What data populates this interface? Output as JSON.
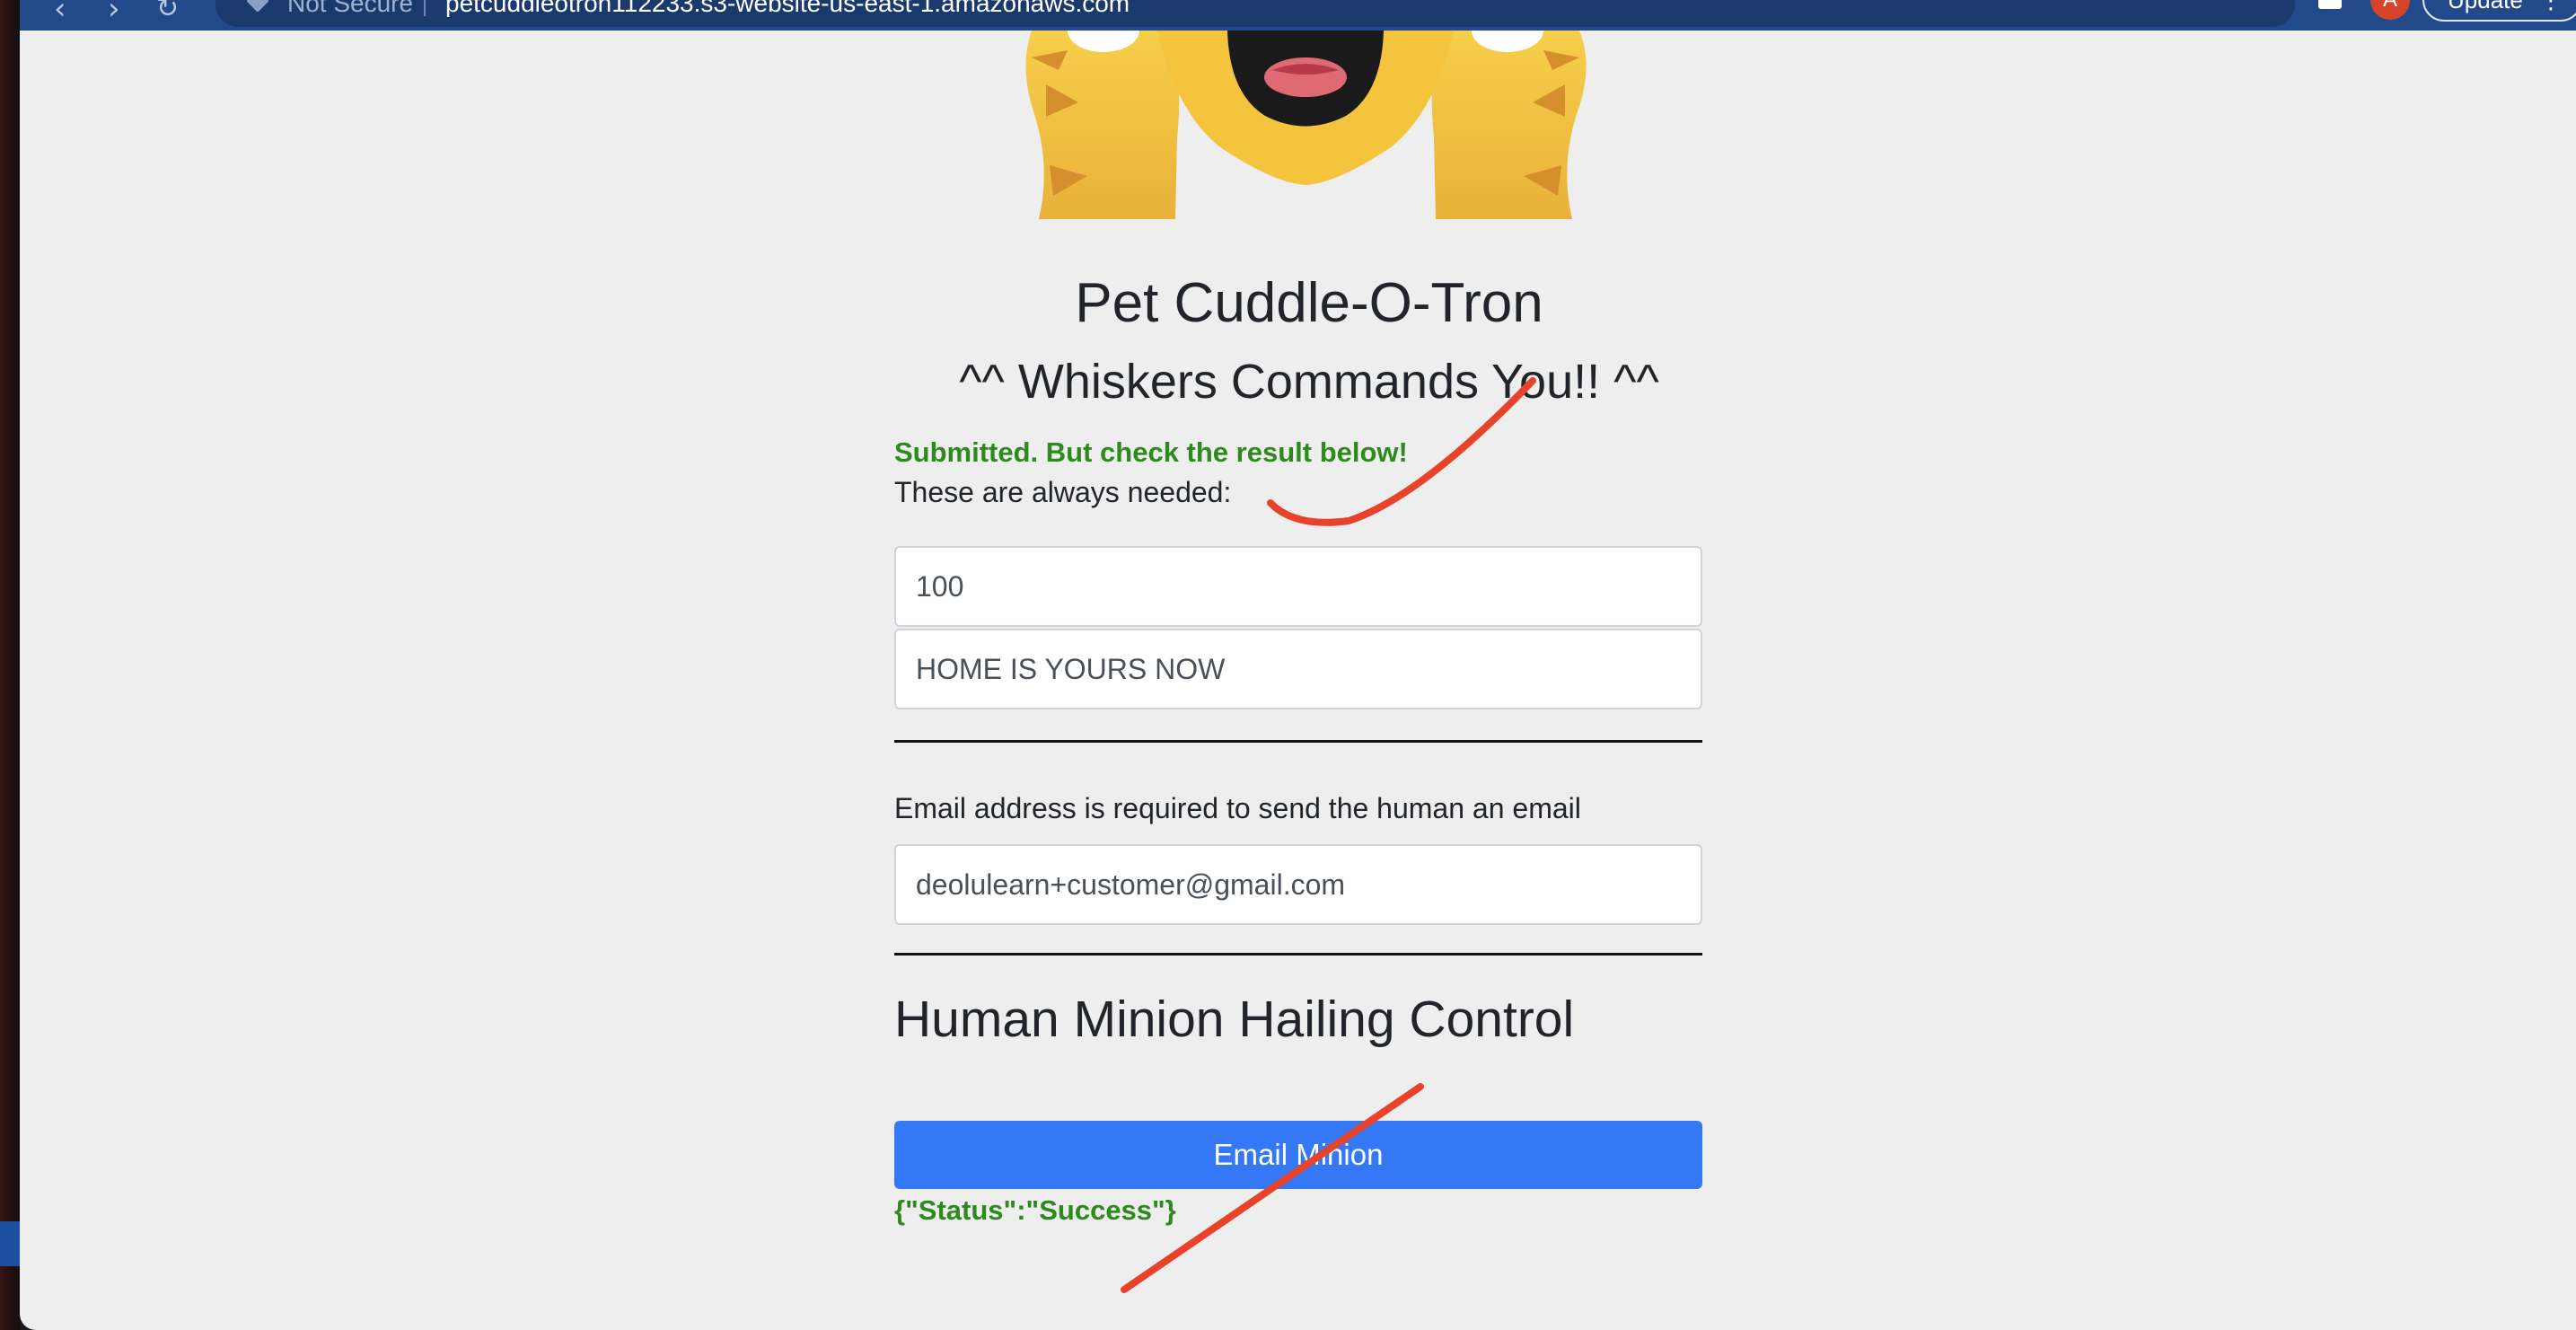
{
  "browser": {
    "security_label": "Not Secure",
    "url": "petcuddleotron112233.s3-website-us-east-1.amazonaws.com",
    "avatar_initial": "A",
    "update_label": "Update",
    "icons": [
      "back-arrow-icon",
      "forward-arrow-icon",
      "reload-icon",
      "share-icon",
      "star-icon",
      "extensions-icon",
      "kebab-menu-icon"
    ]
  },
  "page": {
    "title": "Pet Cuddle-O-Tron",
    "subtitle": "^^ Whiskers Commands You!! ^^",
    "submitted_message": "Submitted. But check the result below!",
    "always_needed_label": "These are always needed:",
    "fields": {
      "field_1_value": "100",
      "field_2_value": "HOME IS YOURS NOW",
      "email_label": "Email address is required to send the human an email",
      "email_value": "deolulearn+customer@gmail.com"
    },
    "section_title": "Human Minion Hailing Control",
    "email_button_label": "Email Minion",
    "status_response": "{\"Status\":\"Success\"}"
  },
  "colors": {
    "page_background": "#eeeeee",
    "toolbar": "#224a8a",
    "primary_button": "#3478f6",
    "success_text": "#2e8a1e",
    "annotation_red": "#e8432a",
    "cat_yellow": "#f2c13c"
  }
}
